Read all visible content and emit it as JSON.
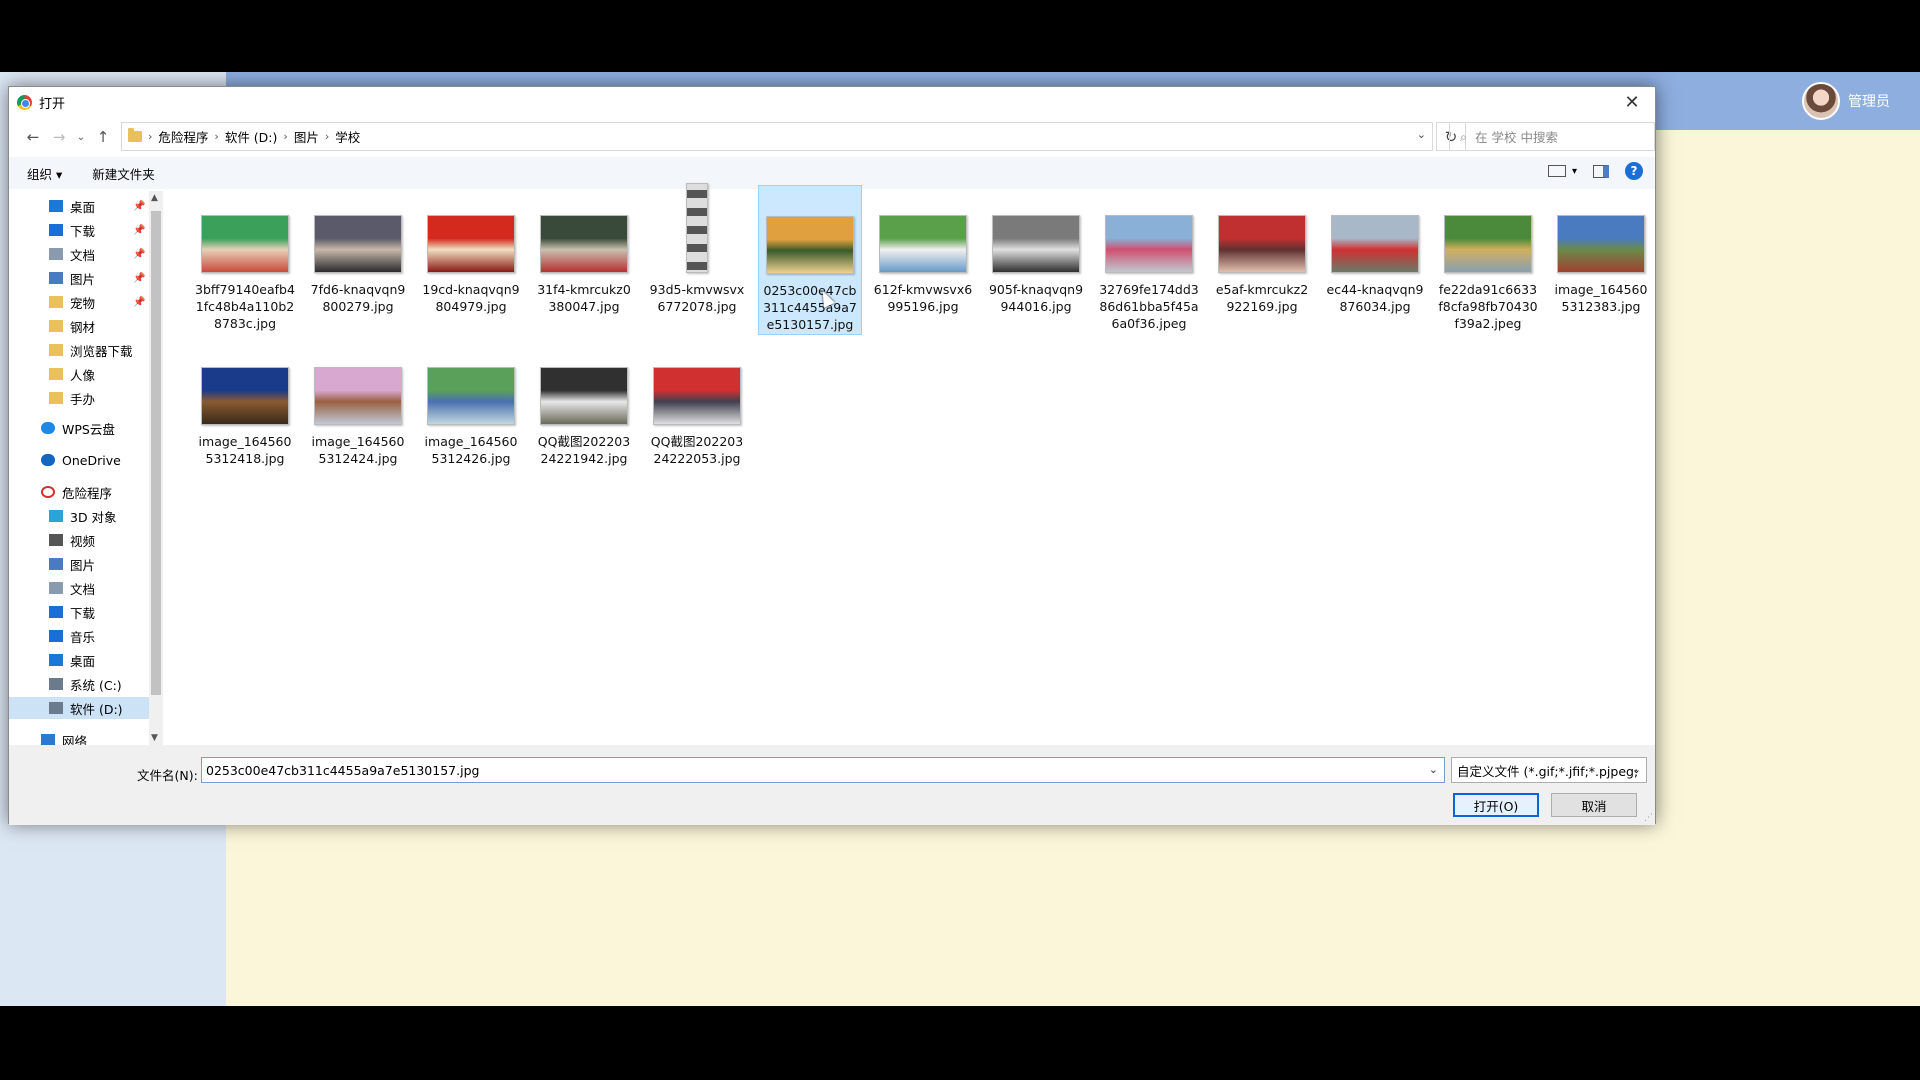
{
  "app": {
    "user_name": "管理员"
  },
  "dialog": {
    "title": "打开",
    "close_label": "✕",
    "breadcrumb": [
      "危险程序",
      "软件 (D:)",
      "图片",
      "学校"
    ],
    "search_placeholder": "在 学校 中搜索",
    "toolbar": {
      "organize": "组织 ▾",
      "new_folder": "新建文件夹"
    },
    "nav_items": [
      {
        "label": "桌面",
        "icon": "desktop-icon",
        "color": "#1a78d6",
        "pinned": true
      },
      {
        "label": "下载",
        "icon": "download-icon",
        "color": "#1a6ed8",
        "pinned": true
      },
      {
        "label": "文档",
        "icon": "document-icon",
        "color": "#8a9bb0",
        "pinned": true
      },
      {
        "label": "图片",
        "icon": "pictures-icon",
        "color": "#4a7bc0",
        "pinned": true
      },
      {
        "label": "宠物",
        "icon": "folder-icon",
        "color": "#e8c15a",
        "pinned": true
      },
      {
        "label": "钢材",
        "icon": "folder-icon",
        "color": "#e8c15a",
        "pinned": false
      },
      {
        "label": "浏览器下载",
        "icon": "folder-icon",
        "color": "#e8c15a",
        "pinned": false
      },
      {
        "label": "人像",
        "icon": "folder-icon",
        "color": "#e8c15a",
        "pinned": false
      },
      {
        "label": "手办",
        "icon": "folder-icon",
        "color": "#e8c15a",
        "pinned": false
      },
      {
        "label": "WPS云盘",
        "icon": "cloud-icon",
        "color": "#1e88e5",
        "pinned": false
      },
      {
        "label": "OneDrive",
        "icon": "onedrive-icon",
        "color": "#1565c0",
        "pinned": false
      },
      {
        "label": "危险程序",
        "icon": "no-entry-icon",
        "color": "#d32f2f",
        "pinned": false
      },
      {
        "label": "3D 对象",
        "icon": "cube-icon",
        "color": "#2aa4d6",
        "pinned": false
      },
      {
        "label": "视频",
        "icon": "video-icon",
        "color": "#555555",
        "pinned": false
      },
      {
        "label": "图片",
        "icon": "pictures-icon",
        "color": "#4a7bc0",
        "pinned": false
      },
      {
        "label": "文档",
        "icon": "document-icon",
        "color": "#8a9bb0",
        "pinned": false
      },
      {
        "label": "下载",
        "icon": "download-icon",
        "color": "#1a6ed8",
        "pinned": false
      },
      {
        "label": "音乐",
        "icon": "music-icon",
        "color": "#1a6ed8",
        "pinned": false
      },
      {
        "label": "桌面",
        "icon": "desktop-icon",
        "color": "#1a78d6",
        "pinned": false
      },
      {
        "label": "系统 (C:)",
        "icon": "drive-icon",
        "color": "#6b7a8c",
        "pinned": false
      },
      {
        "label": "软件 (D:)",
        "icon": "drive-icon",
        "color": "#6b7a8c",
        "pinned": false
      },
      {
        "label": "网络",
        "icon": "network-icon",
        "color": "#2a7bd0",
        "pinned": false
      }
    ],
    "files": [
      {
        "name": "3bff79140eafb41fc48b4a110b28783c.jpg",
        "palette": [
          "#3aa05a",
          "#e7d0b8",
          "#c94a3a"
        ],
        "shape": "wide"
      },
      {
        "name": "7fd6-knaqvqn9800279.jpg",
        "palette": [
          "#5a5a6a",
          "#c8b8a8",
          "#2a2a30"
        ],
        "shape": "wide"
      },
      {
        "name": "19cd-knaqvqn9804979.jpg",
        "palette": [
          "#d42a1e",
          "#f0e0c0",
          "#8a1a14"
        ],
        "shape": "wide"
      },
      {
        "name": "31f4-kmrcukz0380047.jpg",
        "palette": [
          "#3a4a3a",
          "#c8c0b0",
          "#b83030"
        ],
        "shape": "wide"
      },
      {
        "name": "93d5-kmvwsvx6772078.jpg",
        "palette": [
          "#dddddd",
          "#555555",
          "#888888"
        ],
        "shape": "tall"
      },
      {
        "name": "0253c00e47cb311c4455a9a7e5130157.jpg",
        "palette": [
          "#e0a040",
          "#3a5a2a",
          "#f0d090"
        ],
        "shape": "wide"
      },
      {
        "name": "612f-kmvwsvx6995196.jpg",
        "palette": [
          "#5aa04a",
          "#f0f0f0",
          "#6a9ac8"
        ],
        "shape": "wide"
      },
      {
        "name": "905f-knaqvqn9944016.jpg",
        "palette": [
          "#7a7a7a",
          "#e0e0e0",
          "#303030"
        ],
        "shape": "wide"
      },
      {
        "name": "32769fe174dd386d61bba5f45a6a0f36.jpeg",
        "palette": [
          "#8ab0d8",
          "#d05070",
          "#c0c8d0"
        ],
        "shape": "wide"
      },
      {
        "name": "e5af-kmrcukz2922169.jpg",
        "palette": [
          "#c03030",
          "#603030",
          "#e0c0b0"
        ],
        "shape": "wide"
      },
      {
        "name": "ec44-knaqvqn9876034.jpg",
        "palette": [
          "#a8b8c8",
          "#d03030",
          "#6a7a6a"
        ],
        "shape": "wide"
      },
      {
        "name": "fe22da91c6633f8cfa98fb70430f39a2.jpeg",
        "palette": [
          "#4a8a3a",
          "#d0b060",
          "#8aa0b0"
        ],
        "shape": "wide"
      },
      {
        "name": "image_1645605312383.jpg",
        "palette": [
          "#4a7ac0",
          "#6a8a4a",
          "#a04030"
        ],
        "shape": "wide"
      },
      {
        "name": "image_1645605312418.jpg",
        "palette": [
          "#1a3a8a",
          "#8a5a30",
          "#3a2a1a"
        ],
        "shape": "wide"
      },
      {
        "name": "image_1645605312424.jpg",
        "palette": [
          "#d8a8d0",
          "#9a6040",
          "#c0c8d8"
        ],
        "shape": "wide"
      },
      {
        "name": "image_1645605312426.jpg",
        "palette": [
          "#5aa05a",
          "#4a70b0",
          "#c0d8e0"
        ],
        "shape": "wide"
      },
      {
        "name": "QQ截图20220324221942.jpg",
        "palette": [
          "#303030",
          "#e8e8e8",
          "#6a6a5a"
        ],
        "shape": "wide"
      },
      {
        "name": "QQ截图20220324222053.jpg",
        "palette": [
          "#d03030",
          "#404050",
          "#e0e0e0"
        ],
        "shape": "wide"
      }
    ],
    "selected_file_index": 5,
    "filename_label": "文件名(N):",
    "filename_value": "0253c00e47cb311c4455a9a7e5130157.jpg",
    "filetype_value": "自定义文件 (*.gif;*.jfif;*.pjpeg;",
    "open_button": "打开(O)",
    "cancel_button": "取消"
  }
}
